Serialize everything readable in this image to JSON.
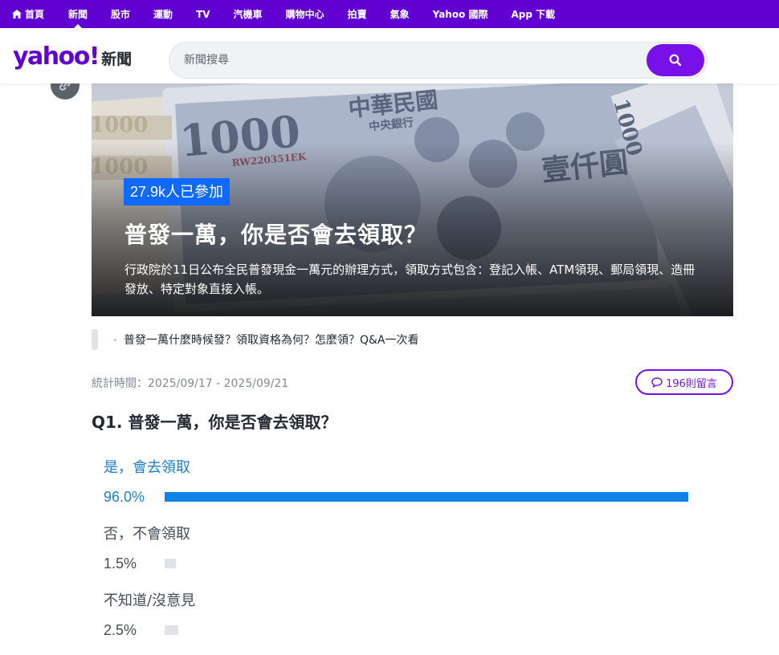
{
  "nav": {
    "items": [
      {
        "label": "首頁",
        "icon": "home-icon"
      },
      {
        "label": "新聞",
        "active": true
      },
      {
        "label": "股市"
      },
      {
        "label": "運動"
      },
      {
        "label": "TV"
      },
      {
        "label": "汽機車"
      },
      {
        "label": "購物中心"
      },
      {
        "label": "拍賣"
      },
      {
        "label": "氣象"
      },
      {
        "label": "Yahoo 國際"
      },
      {
        "label": "App 下載"
      }
    ]
  },
  "header": {
    "logo_word": "yahoo!",
    "logo_sub": "新聞",
    "search_placeholder": "新聞搜尋",
    "search_icon": "search-icon"
  },
  "colors": {
    "brand": "#6001d2",
    "accent": "#7810ea",
    "badge": "#0f69ff",
    "lead_bar": "#0f82e6",
    "lead_text": "#1f7fc9"
  },
  "hero": {
    "participants": "27.9k人已參加",
    "title": "普發一萬，你是否會去領取？",
    "description": "行政院於11日公布全民普發現金一萬元的辦理方式，領取方式包含：登記入帳、ATM領現、郵局領現、造冊發放、特定對象直接入帳。",
    "share_icon": "link-icon"
  },
  "related": {
    "link": "普發一萬什麼時候發？領取資格為何？怎麼領？Q&A一次看"
  },
  "poll": {
    "period": "統計時間：2025/09/17 - 2025/09/21",
    "comments": "196則留言",
    "question": "Q1. 普發一萬，你是否會去領取？",
    "options": [
      {
        "label": "是，會去領取",
        "percent_text": "96.0%",
        "percent": 96.0,
        "lead": true
      },
      {
        "label": "否，不會領取",
        "percent_text": "1.5%",
        "percent": 1.5,
        "lead": false
      },
      {
        "label": "不知道/沒意見",
        "percent_text": "2.5%",
        "percent": 2.5,
        "lead": false
      }
    ]
  }
}
